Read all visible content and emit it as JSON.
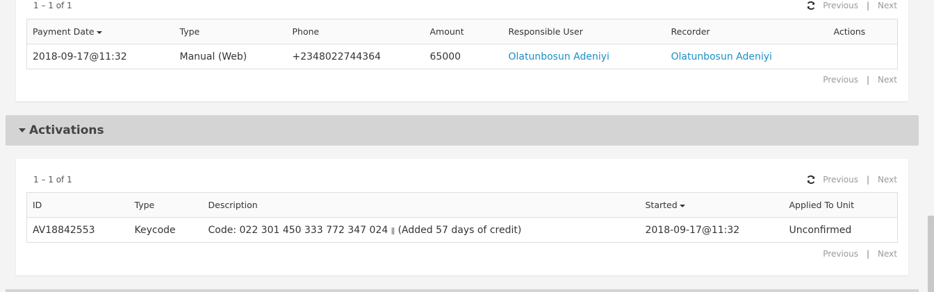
{
  "payments": {
    "count_text": "1 – 1 of 1",
    "pager": {
      "previous": "Previous",
      "separator": "|",
      "next": "Next"
    },
    "columns": [
      "Payment Date",
      "Type",
      "Phone",
      "Amount",
      "Responsible User",
      "Recorder",
      "Actions"
    ],
    "rows": [
      {
        "payment_date": "2018-09-17@11:32",
        "type": "Manual (Web)",
        "phone": "+2348022744364",
        "amount": "65000",
        "responsible_user": "Olatunbosun Adeniyi",
        "recorder": "Olatunbosun Adeniyi",
        "actions": ""
      }
    ],
    "bottom_pager": {
      "previous": "Previous",
      "separator": "|",
      "next": "Next"
    }
  },
  "activations": {
    "section_title": "Activations",
    "count_text": "1 – 1 of 1",
    "pager": {
      "previous": "Previous",
      "separator": "|",
      "next": "Next"
    },
    "columns": [
      "ID",
      "Type",
      "Description",
      "Started",
      "Applied To Unit"
    ],
    "rows": [
      {
        "id": "AV18842553",
        "type": "Keycode",
        "description_code": "Code: 022 301 450 333 772 347 024",
        "description_note": "(Added 57 days of credit)",
        "started": "2018-09-17@11:32",
        "applied_to_unit": "Unconfirmed"
      }
    ],
    "bottom_pager": {
      "previous": "Previous",
      "separator": "|",
      "next": "Next"
    }
  },
  "colors": {
    "link": "#1a8fc4",
    "section_header_bg": "#d4d4d4",
    "pager_disabled": "#999999"
  },
  "icons": [
    "refresh-icon",
    "sort-desc-icon",
    "caret-down-icon",
    "pipe-icon"
  ]
}
